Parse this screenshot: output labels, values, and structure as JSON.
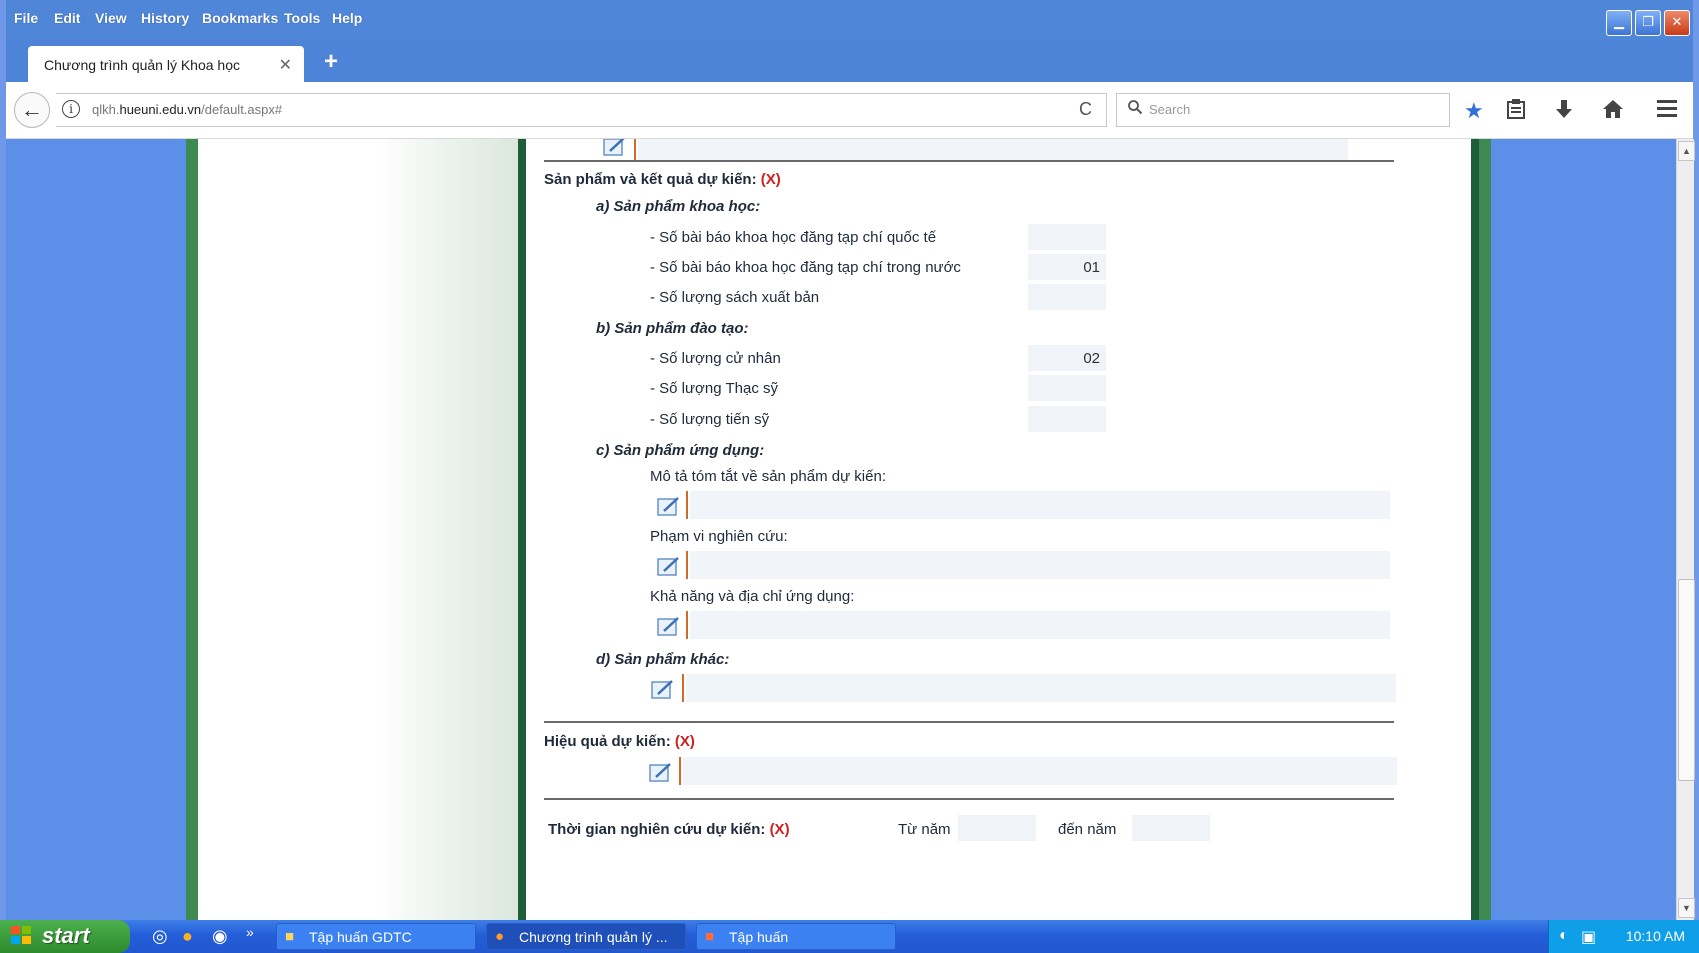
{
  "menu": [
    "File",
    "Edit",
    "View",
    "History",
    "Bookmarks",
    "Tools",
    "Help"
  ],
  "window_controls": {
    "minimize": "▁",
    "restore": "❐",
    "close": "✕"
  },
  "tab": {
    "title": "Chương trình quản lý Khoa học",
    "close": "✕",
    "new_tab": "+"
  },
  "nav": {
    "back": "←",
    "url_prefix": "qlkh.",
    "url_domain": "hueuni.edu.vn",
    "url_path": "/default.aspx#",
    "reload": "C",
    "search_placeholder": "Search"
  },
  "toolbar_icons": [
    "star-icon",
    "clipboard-icon",
    "download-icon",
    "home-icon",
    "menu-icon"
  ],
  "form": {
    "san_pham": {
      "label": "Sản phẩm và kết quả dự kiến:",
      "required": "(X)",
      "khoa_hoc": {
        "label": "a) Sản phẩm khoa học:",
        "items": [
          {
            "label": "- Số bài báo khoa học đăng tạp chí quốc tế",
            "value": ""
          },
          {
            "label": "- Số bài báo khoa học đăng tạp chí trong nước",
            "value": "01"
          },
          {
            "label": "- Số lượng sách xuất bản",
            "value": ""
          }
        ]
      },
      "dao_tao": {
        "label": "b) Sản phẩm đào tạo:",
        "items": [
          {
            "label": "- Số lượng cử nhân",
            "value": "02"
          },
          {
            "label": "- Số lượng Thạc sỹ",
            "value": ""
          },
          {
            "label": "- Số lượng tiến sỹ",
            "value": ""
          }
        ]
      },
      "ung_dung": {
        "label": "c) Sản phẩm ứng dụng:",
        "mo_ta": "Mô tả tóm tắt về sản phẩm dự kiến:",
        "pham_vi": "Phạm vi nghiên cứu:",
        "kha_nang": "Khả năng và địa chỉ ứng dụng:"
      },
      "khac": {
        "label": "d) Sản phẩm khác:"
      }
    },
    "hieu_qua": {
      "label": "Hiệu quả dự kiến:",
      "required": "(X)"
    },
    "thoi_gian": {
      "label": "Thời gian nghiên cứu dự kiến:",
      "required": "(X)",
      "tu_nam": "Từ năm",
      "den_nam": "đến năm"
    }
  },
  "taskbar": {
    "start": "start",
    "tasks": [
      "Tập huấn GDTC",
      "Chương trình quản lý ...",
      "Tập huấn"
    ],
    "quicklaunch_more": "»",
    "clock": "10:10 AM"
  },
  "colors": {
    "accent_required": "#d21d1d",
    "page_bg": "#5b8fe8",
    "green_border": "#1e5f3a"
  }
}
